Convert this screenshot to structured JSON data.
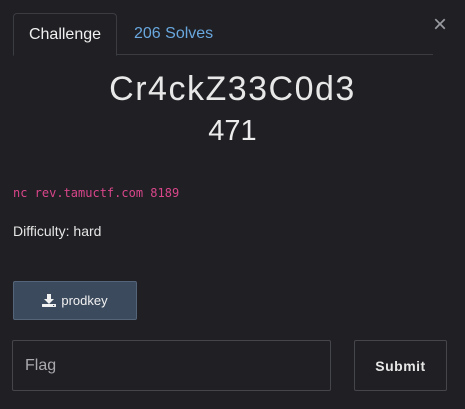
{
  "close_icon": "×",
  "tabs": [
    {
      "label": "Challenge",
      "active": true
    },
    {
      "label": "206 Solves",
      "active": false
    }
  ],
  "challenge": {
    "name": "Cr4ckZ33C0d3",
    "value": "471",
    "connection": "nc rev.tamuctf.com 8189",
    "difficulty": "Difficulty: hard"
  },
  "file": {
    "icon": "download-icon",
    "label": "prodkey"
  },
  "flag_form": {
    "placeholder": "Flag",
    "value": "",
    "submit_label": "Submit"
  },
  "colors": {
    "background": "#1f1f24",
    "link": "#69a7dd",
    "code": "#d9468a",
    "file_button": "#3b4a5c"
  }
}
